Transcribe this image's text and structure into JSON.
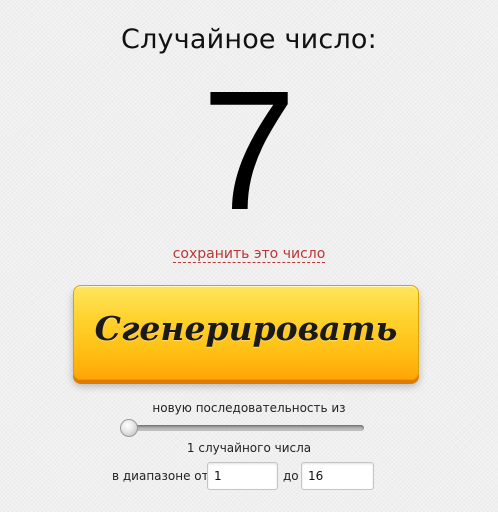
{
  "title": "Случайное число:",
  "result": {
    "value": "7"
  },
  "save_link": "сохранить это число",
  "generate_button": {
    "label": "Сгенерировать",
    "colors": {
      "top": "#ffe65e",
      "bottom": "#ffa507",
      "shadow": "#e07b00"
    }
  },
  "sequence": {
    "label": "новую последовательность из",
    "slider_value": 1,
    "count_text": "1 случайного числа"
  },
  "range": {
    "from_label": "в диапазоне от",
    "from_value": "1",
    "to_label": "до",
    "to_value": "16"
  }
}
